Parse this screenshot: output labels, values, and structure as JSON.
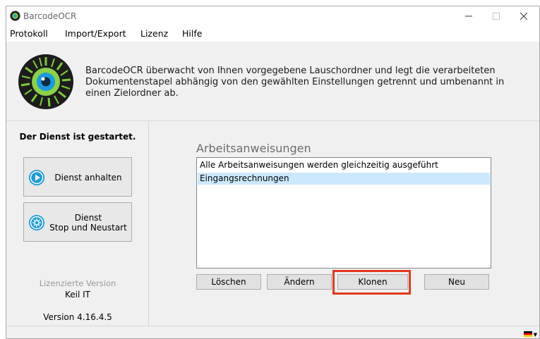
{
  "window": {
    "title": "BarcodeOCR"
  },
  "menu": [
    "Protokoll",
    "Import/Export",
    "Lizenz",
    "Hilfe"
  ],
  "header": {
    "description": "BarcodeOCR überwacht von Ihnen vorgegebene Lauschordner und legt die verarbeiteten Dokumentenstapel abhängig von den gewählten Einstellungen getrennt und umbenannt in einen Zielordner ab."
  },
  "left": {
    "status": "Der Dienst ist gestartet.",
    "stop_label": "Dienst anhalten",
    "restart_line1": "Dienst",
    "restart_line2": "Stop und Neustart",
    "license_label": "Lizenzierte Version",
    "license_name": "Keil IT",
    "version": "Version 4.16.4.5"
  },
  "instructions": {
    "title": "Arbeitsanweisungen",
    "items": [
      {
        "label": "Alle Arbeitsanweisungen werden gleichzeitig ausgeführt",
        "selected": false
      },
      {
        "label": "Eingangsrechnungen",
        "selected": true
      }
    ]
  },
  "buttons": {
    "delete": "Löschen",
    "edit": "Ändern",
    "clone": "Klonen",
    "new": "Neu"
  },
  "colors": {
    "accent": "#1a9be0",
    "highlight": "#e3371e",
    "selection": "#cce8ff"
  },
  "icons": {
    "app": "eye-barcode-icon",
    "stop": "play-circle-icon",
    "restart": "restart-circle-icon",
    "language": "german-flag-icon"
  }
}
